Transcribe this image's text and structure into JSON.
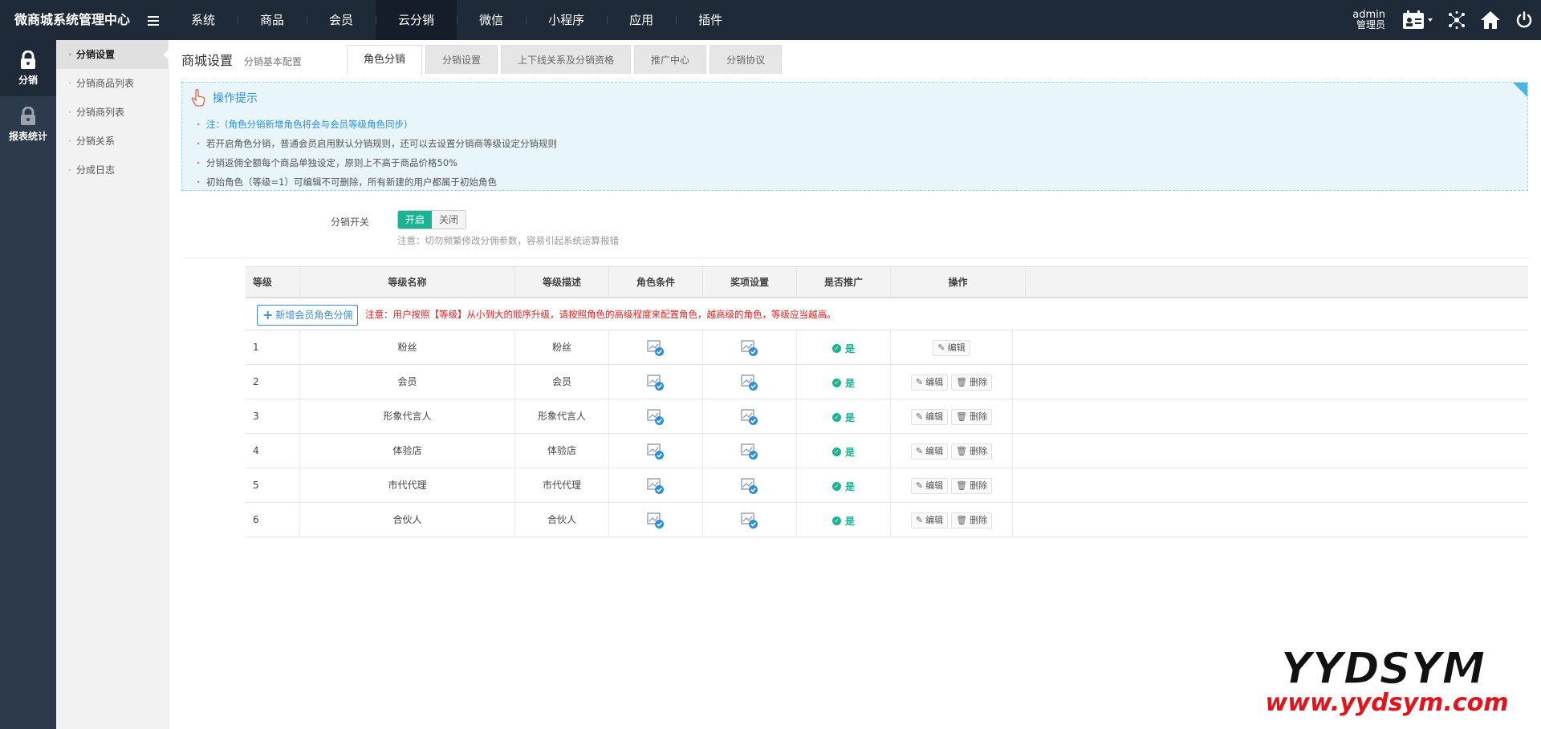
{
  "header": {
    "brand": "微商城系统管理中心",
    "nav": [
      "系统",
      "商品",
      "会员",
      "云分销",
      "微信",
      "小程序",
      "应用",
      "插件"
    ],
    "active_nav": "云分销",
    "user_name": "admin",
    "user_role": "管理员"
  },
  "iconbar": {
    "items": [
      {
        "label": "分销",
        "icon": "lock-icon",
        "active": true
      },
      {
        "label": "报表统计",
        "icon": "lock-icon",
        "active": false
      }
    ]
  },
  "subnav": {
    "items": [
      "分销设置",
      "分销商品列表",
      "分销商列表",
      "分销关系",
      "分成日志"
    ],
    "active": "分销设置"
  },
  "page": {
    "title": "商城设置",
    "subtitle": "分销基本配置",
    "tabs": [
      "角色分销",
      "分销设置",
      "上下线关系及分销资格",
      "推广中心",
      "分销协议"
    ],
    "active_tab": "角色分销"
  },
  "tips": {
    "title": "操作提示",
    "items": [
      "注：(角色分销新增角色将会与会员等级角色同步)",
      "若开启角色分销，普通会员启用默认分销规则，还可以去设置分销商等级设定分销规则",
      "分销返佣全额每个商品单独设定，原则上不高于商品价格50%",
      "初始角色（等级=1）可编辑不可删除，所有新建的用户都属于初始角色"
    ]
  },
  "switch": {
    "label": "分销开关",
    "on_label": "开启",
    "off_label": "关闭",
    "value": "开启",
    "note": "注意：切勿频繁修改分佣参数，容易引起系统运算报错"
  },
  "table": {
    "headers": [
      "等级",
      "等级名称",
      "等级描述",
      "角色条件",
      "奖项设置",
      "是否推广",
      "操作"
    ],
    "add_button": "新增会员角色分佣",
    "notice": "注意：用户按照【等级】从小到大的顺序升级，请按照角色的高级程度来配置角色，越高级的角色，等级应当越高。",
    "edit_label": "编辑",
    "delete_label": "删除",
    "rows": [
      {
        "level": "1",
        "name": "粉丝",
        "desc": "粉丝",
        "promote": "是",
        "deletable": false
      },
      {
        "level": "2",
        "name": "会员",
        "desc": "会员",
        "promote": "是",
        "deletable": true
      },
      {
        "level": "3",
        "name": "形象代言人",
        "desc": "形象代言人",
        "promote": "是",
        "deletable": true
      },
      {
        "level": "4",
        "name": "体验店",
        "desc": "体验店",
        "promote": "是",
        "deletable": true
      },
      {
        "level": "5",
        "name": "市代代理",
        "desc": "市代代理",
        "promote": "是",
        "deletable": true
      },
      {
        "level": "6",
        "name": "合伙人",
        "desc": "合伙人",
        "promote": "是",
        "deletable": true
      }
    ]
  },
  "watermark": {
    "line1": "YYDSYM",
    "line2": "www.yydsym.com"
  },
  "colors": {
    "topbar": "#1f2a38",
    "sidebar": "#2d3a4b",
    "accent_green": "#1ab394",
    "accent_blue": "#2e8fd6",
    "notice_red": "#e02020"
  }
}
